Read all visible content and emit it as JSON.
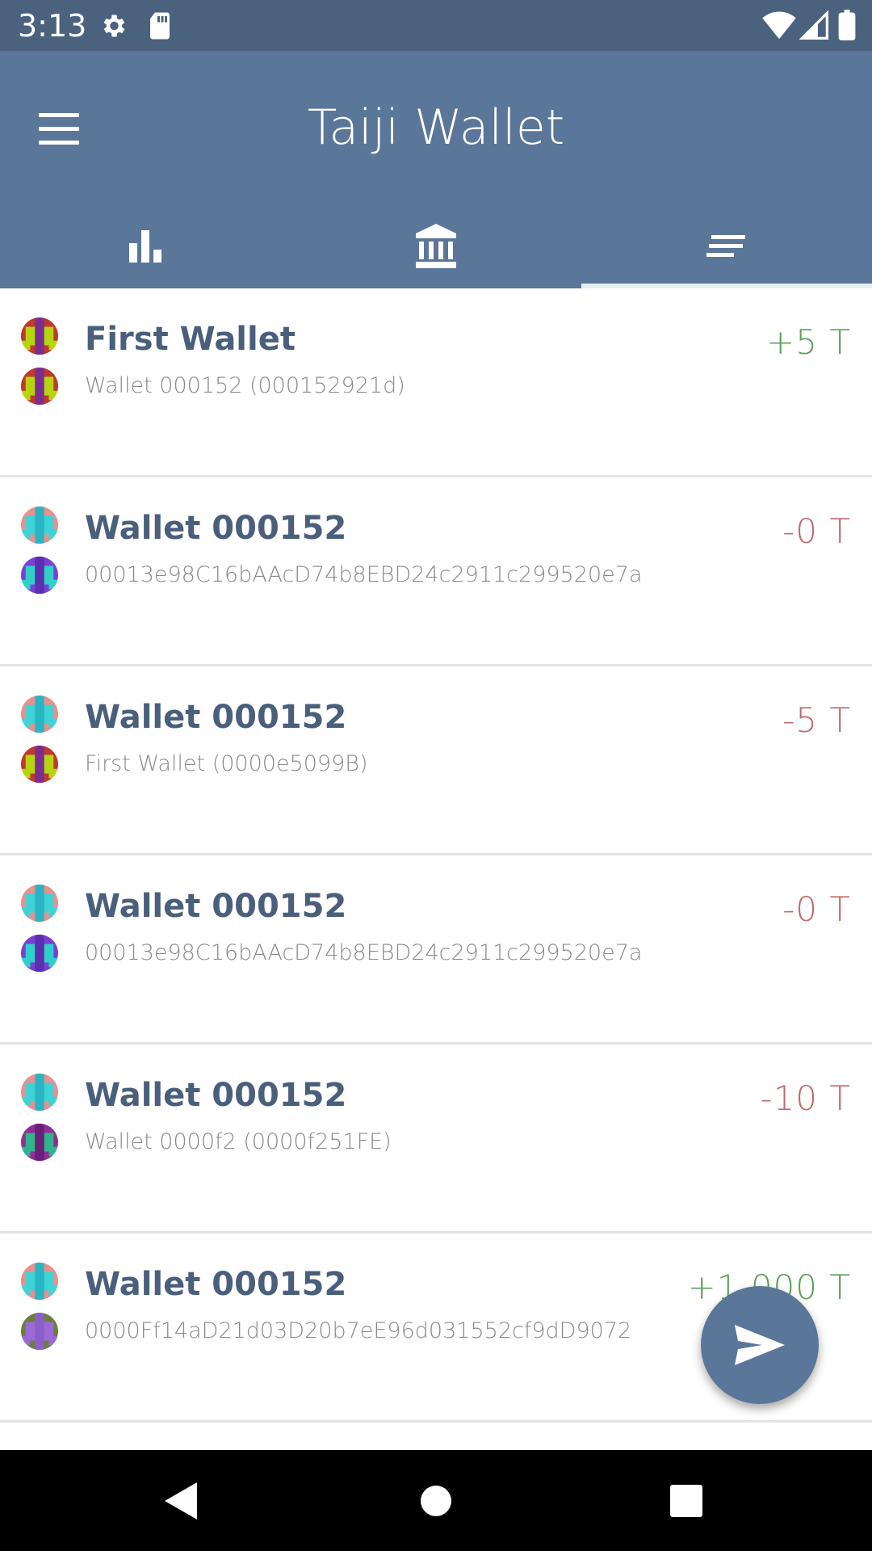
{
  "status_bar": {
    "time": "3:13",
    "icons": [
      "settings-icon",
      "sd-card-icon",
      "wifi-icon",
      "signal-icon",
      "battery-icon"
    ]
  },
  "app_bar": {
    "title": "Taiji Wallet",
    "menu_icon": "menu-icon",
    "background": "#5a7698",
    "tabs": [
      {
        "icon": "bar-chart-icon",
        "selected": false
      },
      {
        "icon": "bank-icon",
        "selected": false
      },
      {
        "icon": "list-icon",
        "selected": true
      }
    ]
  },
  "transactions": [
    {
      "title": "First Wallet",
      "subtitle": "Wallet 000152 (000152921d)",
      "amount": "+5 T",
      "direction": "positive"
    },
    {
      "title": "Wallet 000152",
      "subtitle": "00013e98C16bAAcD74b8EBD24c2911c299520e7a",
      "amount": "-0 T",
      "direction": "negative"
    },
    {
      "title": "Wallet 000152",
      "subtitle": "First Wallet (0000e5099B)",
      "amount": "-5 T",
      "direction": "negative"
    },
    {
      "title": "Wallet 000152",
      "subtitle": "00013e98C16bAAcD74b8EBD24c2911c299520e7a",
      "amount": "-0 T",
      "direction": "negative"
    },
    {
      "title": "Wallet 000152",
      "subtitle": "Wallet 0000f2 (0000f251FE)",
      "amount": "-10 T",
      "direction": "negative"
    },
    {
      "title": "Wallet 000152",
      "subtitle": "0000Ff14aD21d03D20b7eE96d031552cf9dD9072",
      "amount": "+1,000 T",
      "direction": "positive"
    }
  ],
  "colors": {
    "positive": "#5aa05a",
    "negative": "#c06a6a",
    "title_text": "#4a5f7c",
    "status_bar": "#4b627e"
  },
  "fab": {
    "icon": "send-icon"
  },
  "nav_bar": {
    "buttons": [
      "back-icon",
      "home-icon",
      "recents-icon"
    ]
  }
}
